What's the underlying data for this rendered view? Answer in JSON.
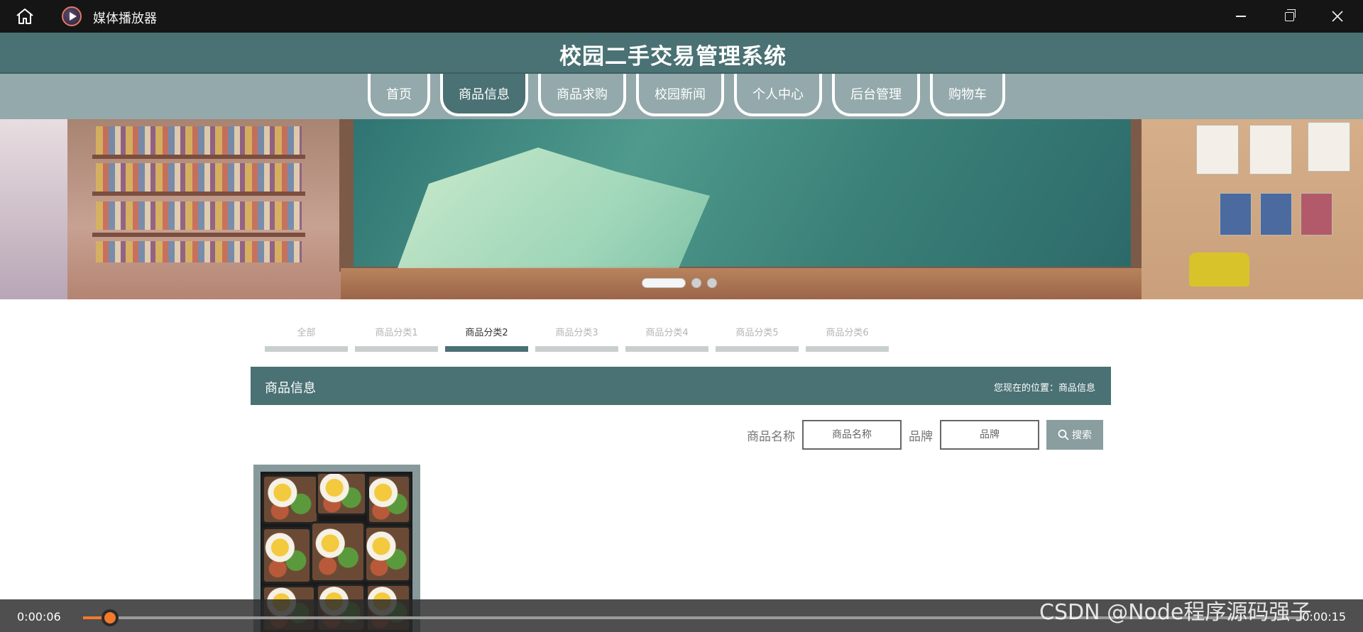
{
  "window": {
    "title": "媒体播放器"
  },
  "site": {
    "title": "校园二手交易管理系统",
    "nav": [
      "首页",
      "商品信息",
      "商品求购",
      "校园新闻",
      "个人中心",
      "后台管理",
      "购物车"
    ],
    "active_nav": 1
  },
  "banner": {
    "slides": 3,
    "active_slide": 0
  },
  "categories": {
    "items": [
      "全部",
      "商品分类1",
      "商品分类2",
      "商品分类3",
      "商品分类4",
      "商品分类5",
      "商品分类6"
    ],
    "active": 2
  },
  "section": {
    "title": "商品信息",
    "breadcrumb_prefix": "您现在的位置：",
    "breadcrumb_current": "商品信息"
  },
  "search": {
    "name_label": "商品名称",
    "name_placeholder": "商品名称",
    "brand_label": "品牌",
    "brand_placeholder": "品牌",
    "button_label": "搜索"
  },
  "player": {
    "current_time": "0:00:06",
    "total_time": "0:00:15",
    "progress": 0.02
  },
  "watermark": "CSDN @Node程序源码强子",
  "colors": {
    "header": "#4a7173",
    "nav_bg": "#94a9ab",
    "progress": "#f27a2a"
  }
}
